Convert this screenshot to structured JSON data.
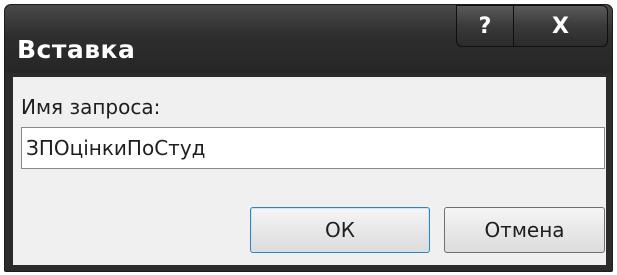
{
  "window": {
    "title": "Вставка",
    "help_glyph": "?",
    "close_glyph": "X"
  },
  "form": {
    "query_label": "Имя запроса:",
    "query_value": "ЗПОцінкиПоСтуд"
  },
  "buttons": {
    "ok_label": "ОК",
    "cancel_label": "Отмена"
  },
  "colors": {
    "titlebar": "#2b2b2b",
    "client_bg": "#f0f0f0",
    "default_button_border": "#3c7fb1"
  }
}
